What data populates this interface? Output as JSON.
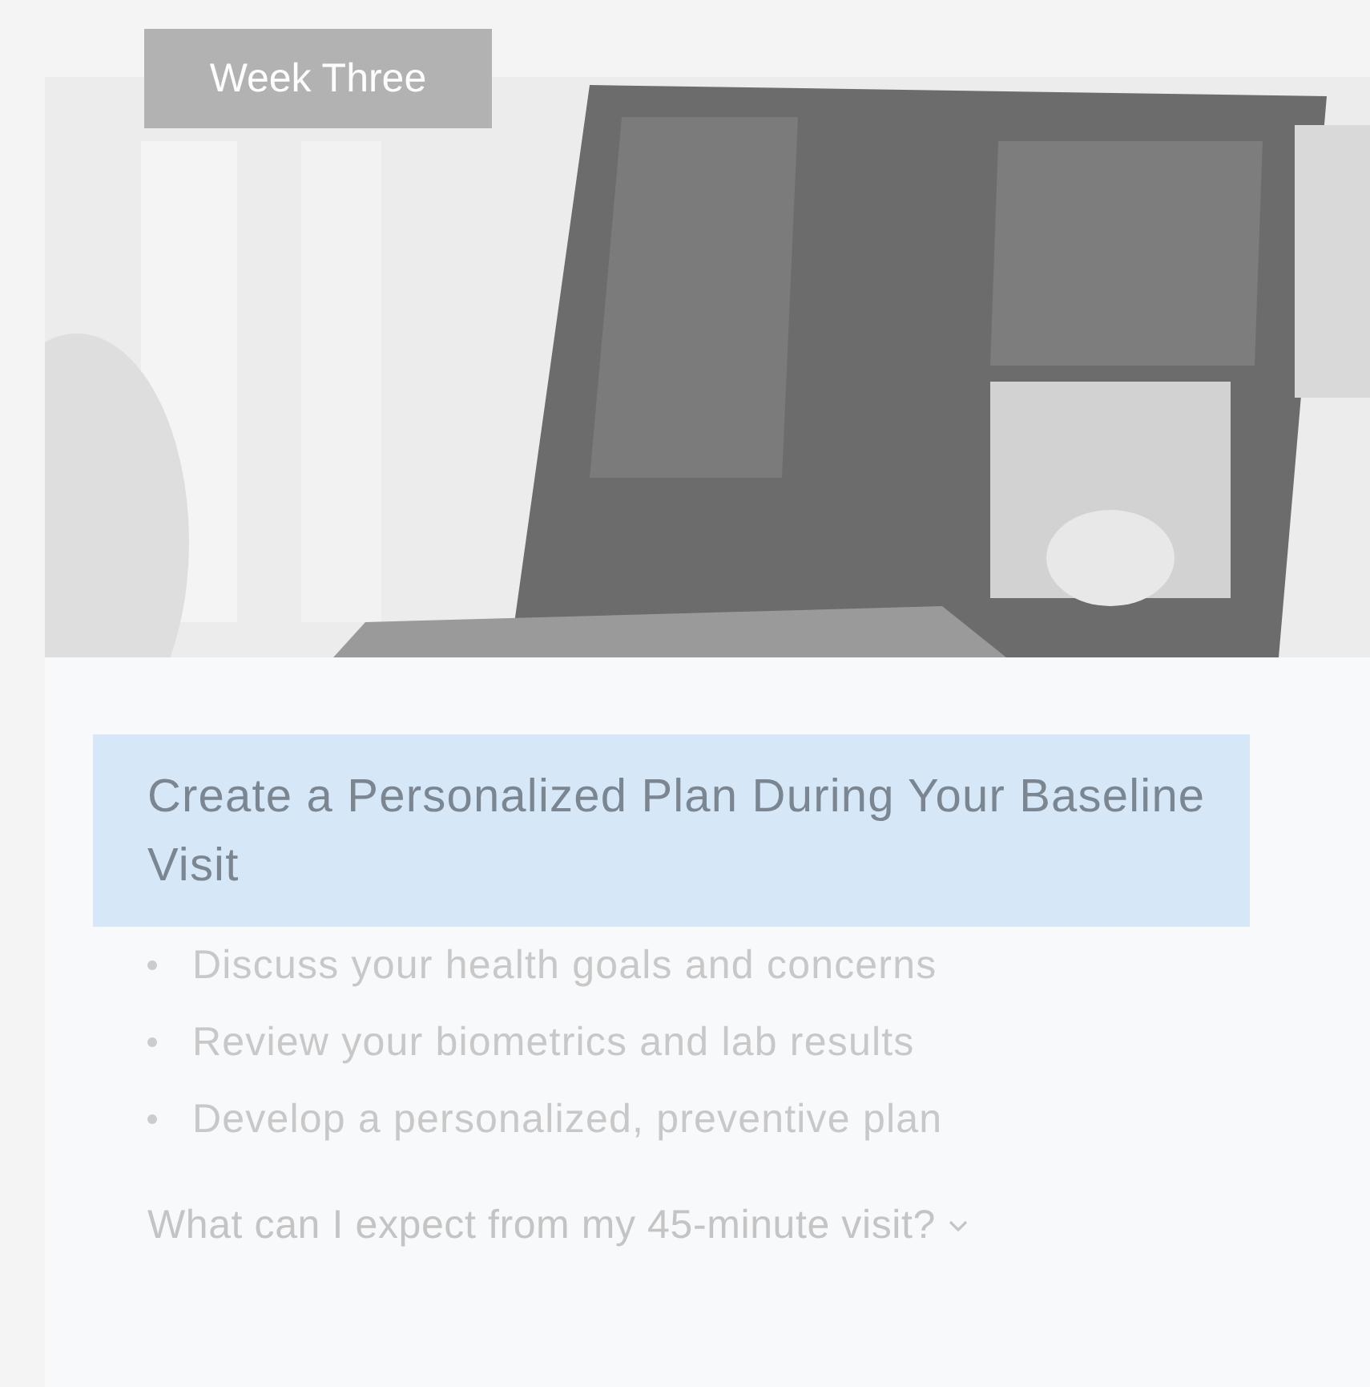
{
  "card": {
    "tag": "Week Three",
    "heading": "Create a Personalized Plan During Your Baseline Visit",
    "bullets": [
      "Discuss your health goals and concerns",
      "Review your biometrics and lab results",
      "Develop a personalized, preventive plan"
    ],
    "link": {
      "label": "What can I expect from my 45-minute visit?",
      "expanded": false
    }
  }
}
